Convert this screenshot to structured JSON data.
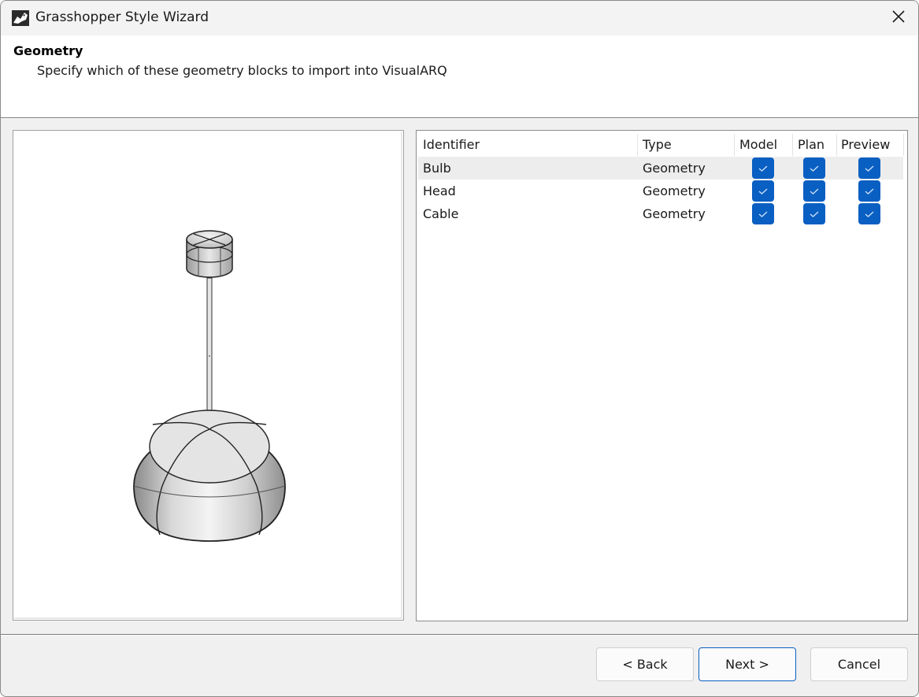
{
  "window": {
    "title": "Grasshopper Style Wizard"
  },
  "header": {
    "title": "Geometry",
    "subtitle": "Specify which of these geometry blocks to import into VisualARQ"
  },
  "table": {
    "columns": [
      "Identifier",
      "Type",
      "Model",
      "Plan",
      "Preview"
    ],
    "rows": [
      {
        "identifier": "Bulb",
        "type": "Geometry",
        "model": true,
        "plan": true,
        "preview": true,
        "selected": true
      },
      {
        "identifier": "Head",
        "type": "Geometry",
        "model": true,
        "plan": true,
        "preview": true,
        "selected": false
      },
      {
        "identifier": "Cable",
        "type": "Geometry",
        "model": true,
        "plan": true,
        "preview": true,
        "selected": false
      }
    ]
  },
  "buttons": {
    "back": "< Back",
    "next": "Next >",
    "cancel": "Cancel"
  },
  "colors": {
    "checkbox": "#0a5fc2",
    "selected_row": "#ededed",
    "primary_border": "#0a5fc2"
  },
  "icons": {
    "app": "grasshopper-rhino-icon",
    "close": "close-icon",
    "check": "checkmark-icon"
  }
}
